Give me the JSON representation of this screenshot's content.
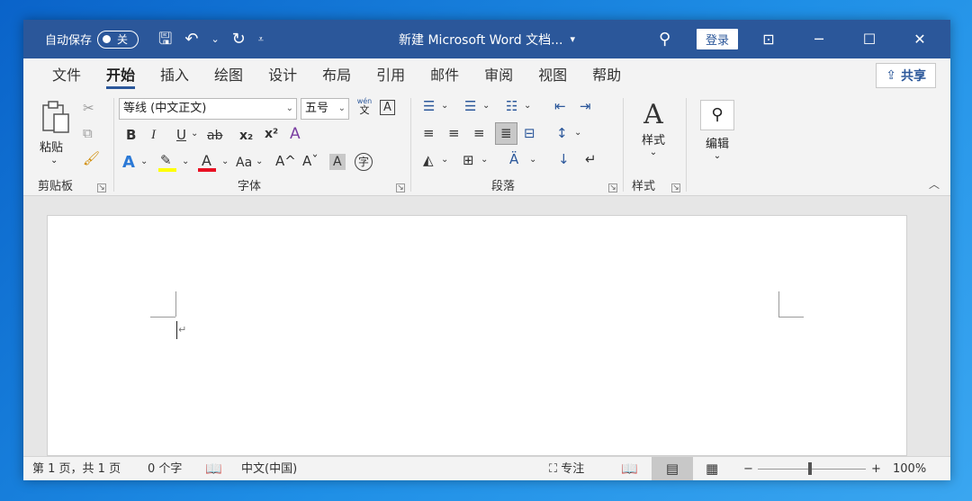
{
  "titlebar": {
    "autosave_label": "自动保存",
    "autosave_state": "关",
    "doc_title": "新建 Microsoft Word 文档...",
    "title_dropdown": "▾",
    "login_label": "登录",
    "qat_save": "🖫",
    "qat_undo": "↶",
    "qat_undo_dd": "⌄",
    "qat_redo": "↻",
    "qat_customize": "⩡",
    "search_icon": "⚲",
    "ribbon_display": "⊡",
    "minimize": "─",
    "maximize": "☐",
    "close": "✕"
  },
  "tabs": [
    "文件",
    "开始",
    "插入",
    "绘图",
    "设计",
    "布局",
    "引用",
    "邮件",
    "审阅",
    "视图",
    "帮助"
  ],
  "active_tab": "开始",
  "share_label": "共享",
  "ribbon": {
    "clipboard": {
      "paste_label": "粘贴",
      "group_label": "剪贴板"
    },
    "font": {
      "font_name": "等线 (中文正文)",
      "font_size": "五号",
      "phonetic_top": "wén",
      "phonetic_bottom": "文",
      "char_border": "A",
      "bold": "B",
      "italic": "I",
      "underline": "U",
      "strike": "ab",
      "subscript": "x₂",
      "superscript": "x²",
      "text_effect": "A",
      "highlight": "✎",
      "font_color": "A",
      "change_case": "Aa",
      "grow": "A^",
      "shrink": "Aˇ",
      "char_shading": "A",
      "enclose": "字",
      "group_label": "字体"
    },
    "paragraph": {
      "group_label": "段落"
    },
    "styles": {
      "label": "样式",
      "group_label": "样式"
    },
    "editing": {
      "label": "编辑"
    }
  },
  "document": {
    "paragraph_mark": "↵"
  },
  "status": {
    "page": "第 1 页，共 1 页",
    "words": "0 个字",
    "language": "中文(中国)",
    "focus": "专注",
    "zoom_minus": "−",
    "zoom_plus": "+",
    "zoom": "100%"
  },
  "colors": {
    "accent": "#2b579a",
    "highlight_yellow": "#ffff00",
    "font_red": "#e81123"
  }
}
